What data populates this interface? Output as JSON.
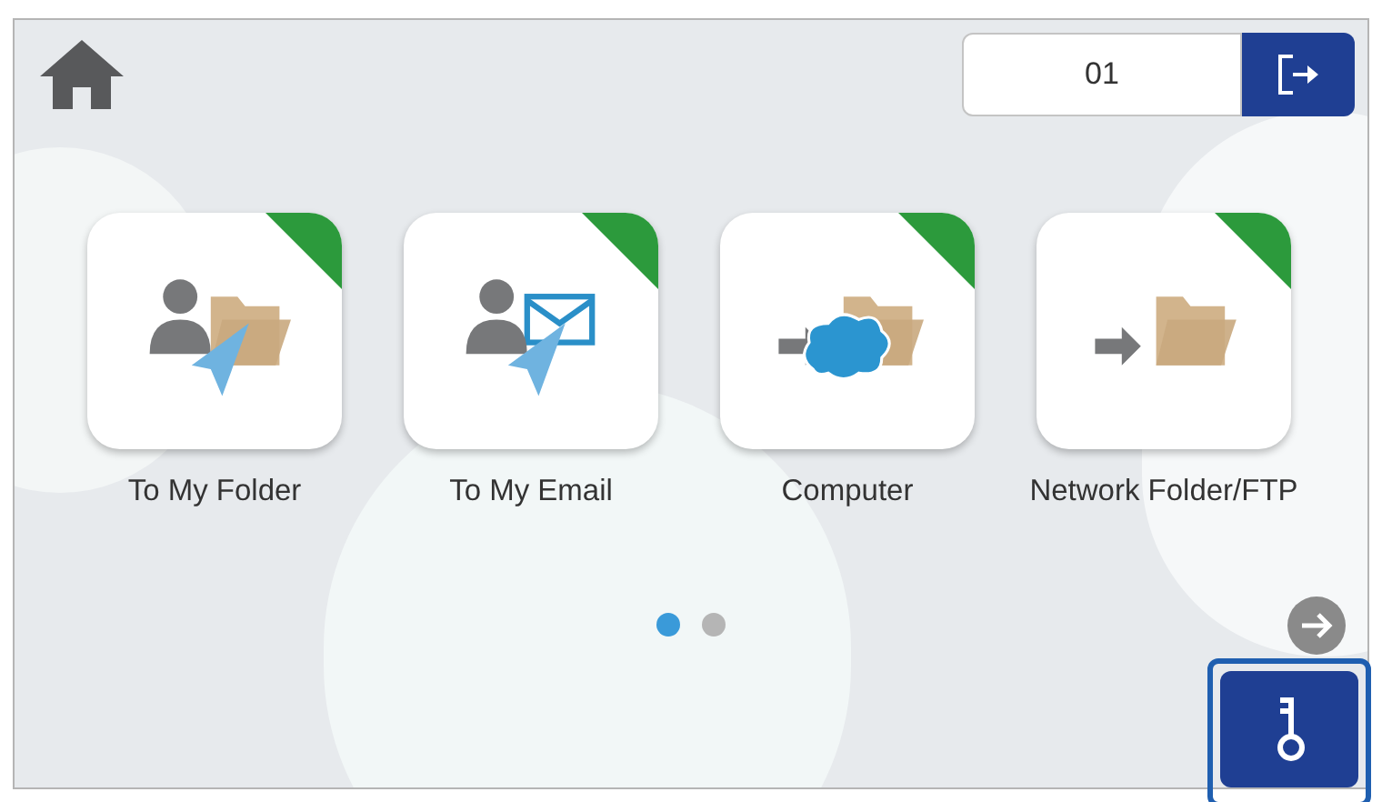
{
  "user_field": {
    "value": "01"
  },
  "tiles": [
    {
      "kind": "my_folder",
      "label": "To My Folder",
      "marked": true
    },
    {
      "kind": "my_email",
      "label": "To My Email",
      "marked": true
    },
    {
      "kind": "computer",
      "label": "Computer",
      "marked": true
    },
    {
      "kind": "network",
      "label": "Network Folder/FTP",
      "marked": true
    }
  ],
  "pages": [
    {
      "selected": true
    },
    {
      "selected": false
    }
  ],
  "key_button": {
    "highlighted": true
  }
}
